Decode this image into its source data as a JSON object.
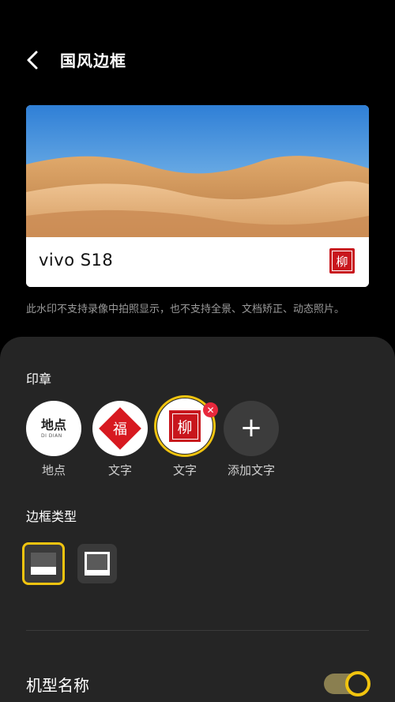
{
  "header": {
    "title": "国风边框"
  },
  "preview": {
    "model_name": "vivo S18",
    "seal_char": "柳"
  },
  "note": "此水印不支持录像中拍照显示，也不支持全景、文档矫正、动态照片。",
  "stamps": {
    "section_title": "印章",
    "items": [
      {
        "label": "地点",
        "glyph": "地点",
        "sub": "DI DIAN"
      },
      {
        "label": "文字",
        "glyph": "福"
      },
      {
        "label": "文字",
        "glyph": "柳",
        "selected": true
      },
      {
        "label": "添加文字",
        "glyph": "+"
      }
    ]
  },
  "frame_type": {
    "section_title": "边框类型",
    "selected_index": 0
  },
  "model_row": {
    "label": "机型名称",
    "toggle_on": true
  },
  "colors": {
    "accent": "#f1c40f",
    "seal_red": "#c8161d",
    "panel": "#252525"
  }
}
